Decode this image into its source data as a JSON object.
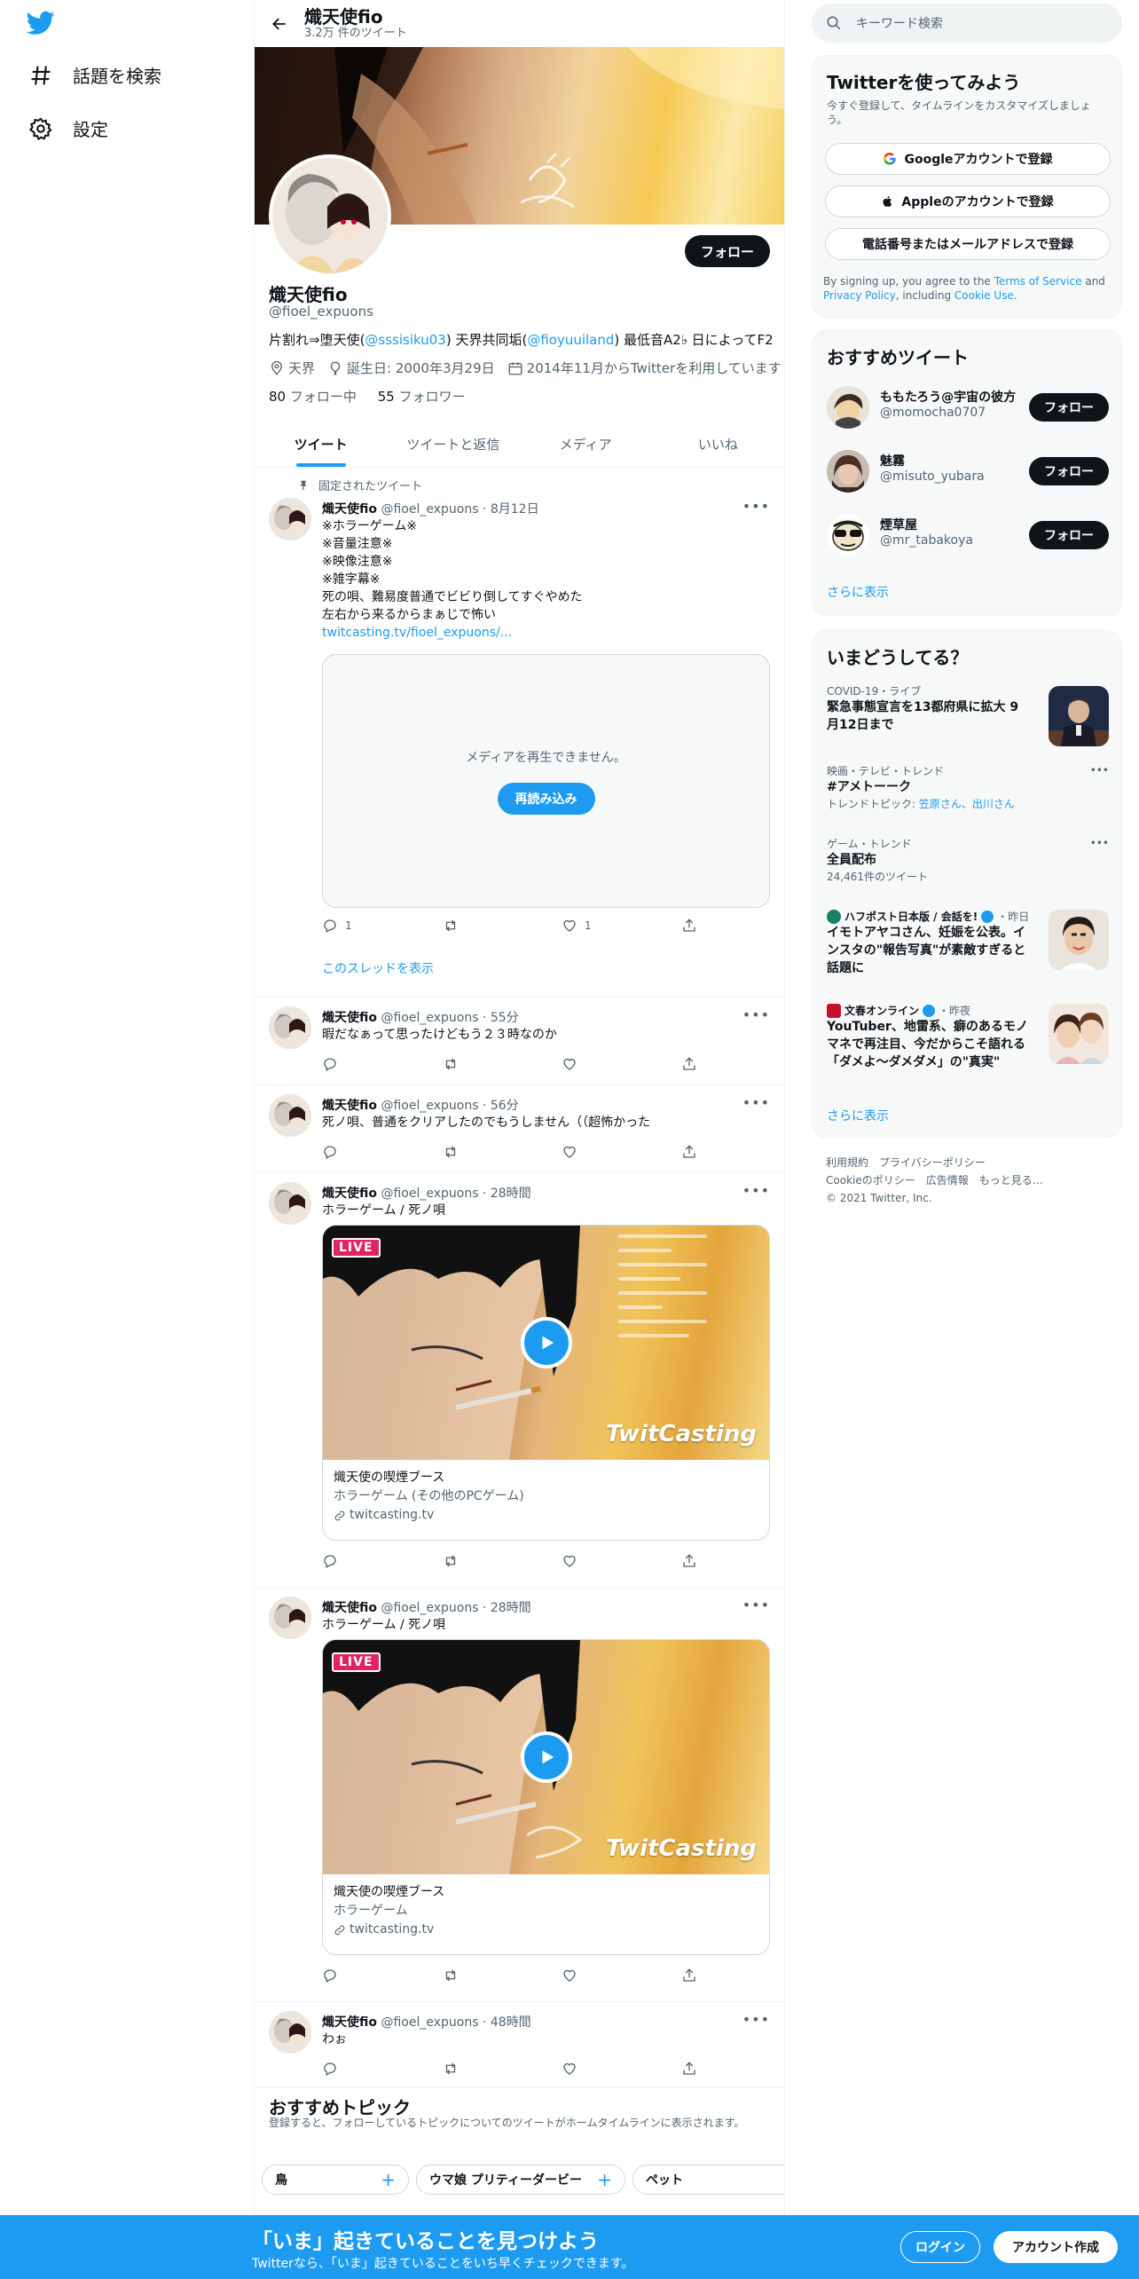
{
  "nav": {
    "explore": "話題を検索",
    "settings": "設定"
  },
  "header": {
    "name": "熾天使fio",
    "tweet_count": "3.2万 件のツイート"
  },
  "profile": {
    "follow": "フォロー",
    "name": "熾天使fio",
    "handle": "@fioel_expuons",
    "bio_pre": "片割れ⇒堕天使(",
    "bio_link1": "@sssisiku03",
    "bio_mid": ") 天界共同垢(",
    "bio_link2": "@fioyuuiland",
    "bio_post": ")  最低音A2♭ 日によってF2",
    "location": "天界",
    "birthday": "誕生日: 2000年3月29日",
    "joined": "2014年11月からTwitterを利用しています",
    "following_count": "80",
    "following_label": "フォロー中",
    "followers_count": "55",
    "followers_label": "フォロワー"
  },
  "tabs": [
    "ツイート",
    "ツイートと返信",
    "メディア",
    "いいね"
  ],
  "pinned_label": "固定されたツイート",
  "tweets": [
    {
      "name": "熾天使fio",
      "handle": "@fioel_expuons",
      "time": "8月12日",
      "lines": [
        "※ホラーゲーム※",
        "※音量注意※",
        "※映像注意※",
        "※雑字幕※",
        "死の唄、難易度普通でビビり倒してすぐやめた",
        "左右から来るからまぁじで怖い"
      ],
      "link": "twitcasting.tv/fioel_expuons/...",
      "media_error": "メディアを再生できません。",
      "reload": "再読み込み",
      "replies": "1",
      "likes": "1",
      "thread": "このスレッドを表示"
    },
    {
      "name": "熾天使fio",
      "handle": "@fioel_expuons",
      "time": "55分",
      "text": "暇だなぁって思ったけどもう２３時なのか"
    },
    {
      "name": "熾天使fio",
      "handle": "@fioel_expuons",
      "time": "56分",
      "text": "死ノ唄、普通をクリアしたのでもうしません（（超怖かった"
    },
    {
      "name": "熾天使fio",
      "handle": "@fioel_expuons",
      "time": "28時間",
      "text": "ホラーゲーム / 死ノ唄",
      "card_title": "熾天使の喫煙ブース",
      "card_desc": "ホラーゲーム (その他のPCゲーム)",
      "card_domain": "twitcasting.tv",
      "live": "LIVE",
      "brand": "TwitCasting"
    },
    {
      "name": "熾天使fio",
      "handle": "@fioel_expuons",
      "time": "28時間",
      "text": "ホラーゲーム / 死ノ唄",
      "card_title": "熾天使の喫煙ブース",
      "card_desc": "ホラーゲーム",
      "card_domain": "twitcasting.tv",
      "live": "LIVE",
      "brand": "TwitCasting"
    },
    {
      "name": "熾天使fio",
      "handle": "@fioel_expuons",
      "time": "48時間",
      "text": "わぉ"
    }
  ],
  "topics": {
    "title": "おすすめトピック",
    "subtitle": "登録すると、フォローしているトピックについてのツイートがホームタイムラインに表示されます。",
    "chips": [
      "鳥",
      "ウマ娘 プリティーダービー",
      "ペット"
    ]
  },
  "search": {
    "placeholder": "キーワード検索"
  },
  "signup": {
    "title": "Twitterを使ってみよう",
    "subtitle": "今すぐ登録して、タイムラインをカスタマイズしましょう。",
    "google": "Googleアカウントで登録",
    "apple": "Appleのアカウントで登録",
    "phone": "電話番号またはメールアドレスで登録",
    "terms_pre": "By signing up, you agree to the ",
    "terms": "Terms of Service",
    "terms_and": " and ",
    "privacy": "Privacy Policy",
    "terms_inc": ", including ",
    "cookie": "Cookie Use",
    "terms_end": "."
  },
  "who_to_follow": {
    "title": "おすすめツイート",
    "users": [
      {
        "name": "ももたろう@宇宙の彼方",
        "handle": "@momocha0707",
        "button": "フォロー"
      },
      {
        "name": "魅霧",
        "handle": "@misuto_yubara",
        "button": "フォロー"
      },
      {
        "name": "煙草屋",
        "handle": "@mr_tabakoya",
        "button": "フォロー"
      }
    ],
    "more": "さらに表示"
  },
  "trends": {
    "title": "いまどうしてる？",
    "items": [
      {
        "context": "COVID-19・ライブ",
        "title": "緊急事態宣言を13都府県に拡大 9月12日まで"
      },
      {
        "context": "映画・テレビ・トレンド",
        "title": "#アメトーーク",
        "sub_pre": "トレンドトピック: ",
        "sub_link": "笠原さん、出川さん"
      },
      {
        "context": "ゲーム・トレンド",
        "title": "全員配布",
        "sub": "24,461件のツイート"
      },
      {
        "context": "ハフポスト日本版 / 会話を!",
        "context_time": "・昨日",
        "title": "イモトアヤコさん、妊娠を公表。インスタの\"報告写真\"が素敵すぎると話題に"
      },
      {
        "context": "文春オンライン",
        "context_time": "・昨夜",
        "title": "YouTuber、地雷系、癖のあるモノマネで再注目、今だからこそ語れる「ダメよ〜ダメダメ」の\"真実\""
      }
    ],
    "more": "さらに表示"
  },
  "footer": {
    "line1": "利用規約　プライバシーポリシー",
    "line2": "Cookieのポリシー　広告情報　もっと見る…",
    "line3": "© 2021 Twitter, Inc."
  },
  "bottom": {
    "title": "「いま」起きていることを見つけよう",
    "subtitle": "Twitterなら、「いま」起きていることをいち早くチェックできます。",
    "login": "ログイン",
    "signup": "アカウント作成"
  },
  "colors": {
    "accent": "#1d9bf0",
    "text": "#0f1419",
    "secondary": "#536471"
  }
}
